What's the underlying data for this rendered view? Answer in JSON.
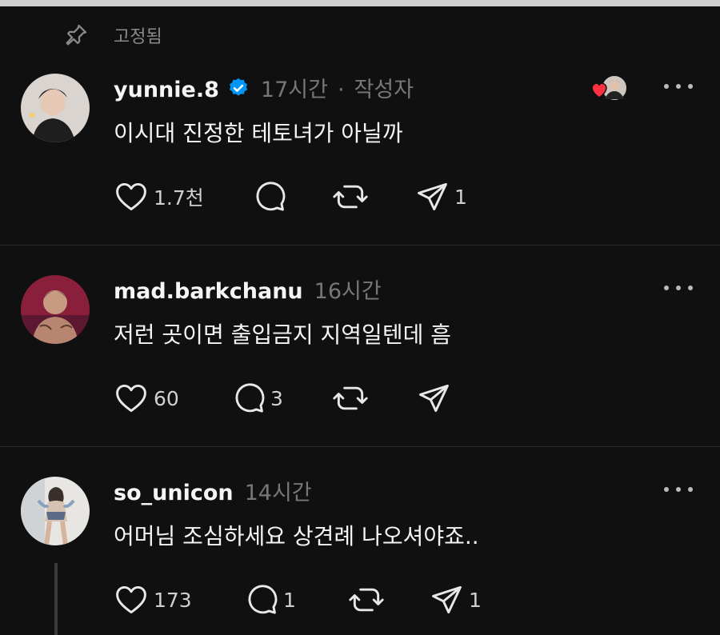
{
  "pinned": {
    "label": "고정됨",
    "icon": "pin-icon"
  },
  "colors": {
    "background": "#101010",
    "verified": "#0095f6",
    "heart_badge": "#ff3040",
    "muted": "#777777"
  },
  "posts": [
    {
      "username": "yunnie.8",
      "verified": true,
      "time": "17시간",
      "separator": "·",
      "author_tag": "작성자",
      "text": "이시대 진정한 테토녀가 아닐까",
      "likes": "1.7천",
      "comments": "",
      "reposts": "",
      "shares": "1",
      "liked_by_author": true
    },
    {
      "username": "mad.barkchanu",
      "verified": false,
      "time": "16시간",
      "text": "저런 곳이면 출입금지 지역일텐데 흠",
      "likes": "60",
      "comments": "3",
      "reposts": "",
      "shares": ""
    },
    {
      "username": "so_unicon",
      "verified": false,
      "time": "14시간",
      "text": "어머님 조심하세요 상견례 나오셔야죠..",
      "likes": "173",
      "comments": "1",
      "reposts": "",
      "shares": "1"
    }
  ]
}
